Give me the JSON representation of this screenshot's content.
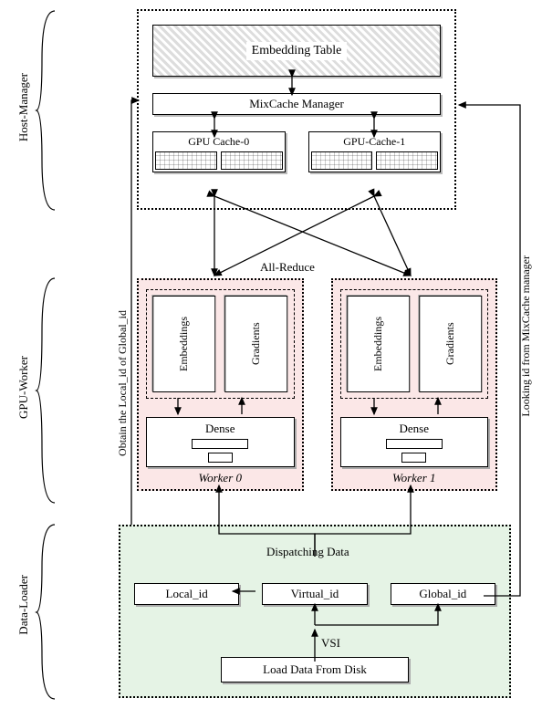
{
  "section_labels": {
    "host_manager": "Host-Manager",
    "gpu_worker": "GPU-Worker",
    "data_loader": "Data-Loader"
  },
  "host": {
    "embedding_table": "Embedding Table",
    "mixcache_manager": "MixCache Manager",
    "gpu_cache_0": "GPU Cache-0",
    "gpu_cache_1": "GPU-Cache-1"
  },
  "all_reduce": "All-Reduce",
  "worker": {
    "embeddings": "Embeddings",
    "gradients": "Gradients",
    "dense": "Dense",
    "worker0": "Worker 0",
    "worker1": "Worker 1"
  },
  "data_loader": {
    "dispatching": "Dispatching Data",
    "local_id": "Local_id",
    "virtual_id": "Virtual_id",
    "global_id": "Global_id",
    "vsi": "VSI",
    "load_from_disk": "Load Data From Disk"
  },
  "side_text": {
    "obtain": "Obtain the Local_id of Global_id",
    "looking": "Looking id from MixCache manager"
  }
}
